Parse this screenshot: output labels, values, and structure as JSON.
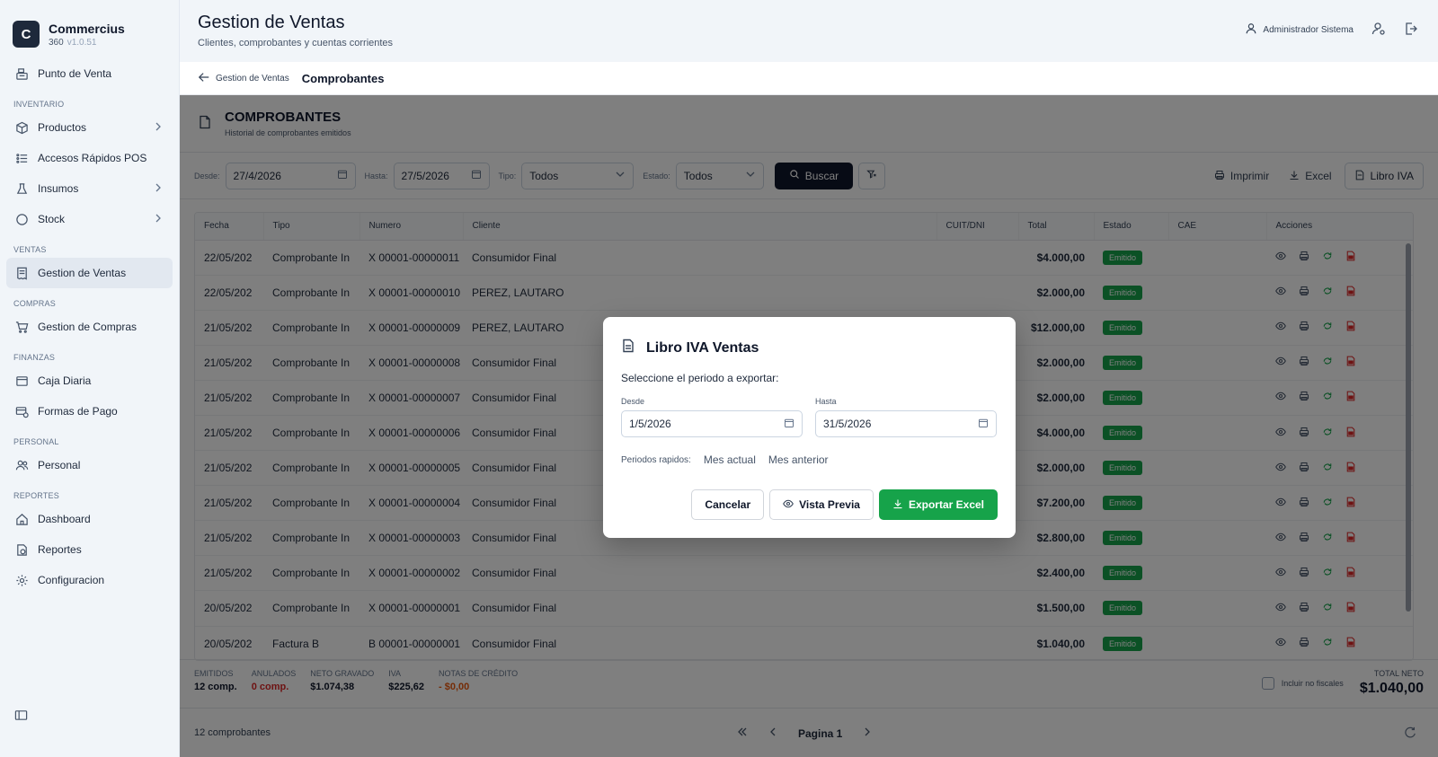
{
  "brand": {
    "logo_letter": "C",
    "name": "Commercius",
    "sub": "360",
    "version": "v1.0.51"
  },
  "sidebar": {
    "pos": "Punto de Venta",
    "sections": {
      "inventario": "INVENTARIO",
      "ventas": "VENTAS",
      "compras": "COMPRAS",
      "finanzas": "FINANZAS",
      "personal": "PERSONAL",
      "reportes": "REPORTES"
    },
    "items": {
      "productos": "Productos",
      "accesos": "Accesos Rápidos POS",
      "insumos": "Insumos",
      "stock": "Stock",
      "gestion_ventas": "Gestion de Ventas",
      "gestion_compras": "Gestion de Compras",
      "caja": "Caja Diaria",
      "formas_pago": "Formas de Pago",
      "personal": "Personal",
      "dashboard": "Dashboard",
      "reportes": "Reportes",
      "configuracion": "Configuracion"
    }
  },
  "header": {
    "title": "Gestion de Ventas",
    "subtitle": "Clientes, comprobantes y cuentas corrientes",
    "user": "Administrador Sistema"
  },
  "breadcrumb": {
    "back": "Gestion de Ventas",
    "current": "Comprobantes"
  },
  "section": {
    "title": "COMPROBANTES",
    "subtitle": "Historial de comprobantes emitidos"
  },
  "filters": {
    "desde_label": "Desde:",
    "desde": "27/4/2026",
    "hasta_label": "Hasta:",
    "hasta": "27/5/2026",
    "tipo_label": "Tipo:",
    "tipo": "Todos",
    "estado_label": "Estado:",
    "estado": "Todos",
    "buscar": "Buscar",
    "imprimir": "Imprimir",
    "excel": "Excel",
    "libro_iva": "Libro IVA"
  },
  "table": {
    "columns": {
      "fecha": "Fecha",
      "tipo": "Tipo",
      "numero": "Numero",
      "cliente": "Cliente",
      "cuit": "CUIT/DNI",
      "total": "Total",
      "estado": "Estado",
      "cae": "CAE",
      "acciones": "Acciones"
    },
    "rows": [
      {
        "fecha": "22/05/202",
        "tipo": "Comprobante In",
        "numero": "X 00001-00000011",
        "cliente": "Consumidor Final",
        "total": "$4.000,00",
        "estado": "Emitido"
      },
      {
        "fecha": "22/05/202",
        "tipo": "Comprobante In",
        "numero": "X 00001-00000010",
        "cliente": "PEREZ, LAUTARO",
        "total": "$2.000,00",
        "estado": "Emitido"
      },
      {
        "fecha": "21/05/202",
        "tipo": "Comprobante In",
        "numero": "X 00001-00000009",
        "cliente": "PEREZ, LAUTARO",
        "total": "$12.000,00",
        "estado": "Emitido"
      },
      {
        "fecha": "21/05/202",
        "tipo": "Comprobante In",
        "numero": "X 00001-00000008",
        "cliente": "Consumidor Final",
        "total": "$2.000,00",
        "estado": "Emitido"
      },
      {
        "fecha": "21/05/202",
        "tipo": "Comprobante In",
        "numero": "X 00001-00000007",
        "cliente": "Consumidor Final",
        "total": "$2.000,00",
        "estado": "Emitido"
      },
      {
        "fecha": "21/05/202",
        "tipo": "Comprobante In",
        "numero": "X 00001-00000006",
        "cliente": "Consumidor Final",
        "total": "$4.000,00",
        "estado": "Emitido"
      },
      {
        "fecha": "21/05/202",
        "tipo": "Comprobante In",
        "numero": "X 00001-00000005",
        "cliente": "Consumidor Final",
        "total": "$2.000,00",
        "estado": "Emitido"
      },
      {
        "fecha": "21/05/202",
        "tipo": "Comprobante In",
        "numero": "X 00001-00000004",
        "cliente": "Consumidor Final",
        "total": "$7.200,00",
        "estado": "Emitido"
      },
      {
        "fecha": "21/05/202",
        "tipo": "Comprobante In",
        "numero": "X 00001-00000003",
        "cliente": "Consumidor Final",
        "total": "$2.800,00",
        "estado": "Emitido"
      },
      {
        "fecha": "21/05/202",
        "tipo": "Comprobante In",
        "numero": "X 00001-00000002",
        "cliente": "Consumidor Final",
        "total": "$2.400,00",
        "estado": "Emitido"
      },
      {
        "fecha": "20/05/202",
        "tipo": "Comprobante In",
        "numero": "X 00001-00000001",
        "cliente": "Consumidor Final",
        "total": "$1.500,00",
        "estado": "Emitido"
      },
      {
        "fecha": "20/05/202",
        "tipo": "Factura B",
        "numero": "B 00001-00000001",
        "cliente": "Consumidor Final",
        "total": "$1.040,00",
        "estado": "Emitido"
      }
    ]
  },
  "totals": {
    "emitidos_label": "EMITIDOS",
    "emitidos": "12 comp.",
    "anulados_label": "ANULADOS",
    "anulados": "0 comp.",
    "neto_label": "NETO GRAVADO",
    "neto": "$1.074,38",
    "iva_label": "IVA",
    "iva": "$225,62",
    "nc_label": "NOTAS DE CRÉDITO",
    "nc": "- $0,00",
    "incluir": "Incluir no fiscales",
    "total_neto_label": "TOTAL NETO",
    "total_neto": "$1.040,00"
  },
  "footer": {
    "count": "12 comprobantes",
    "page": "Pagina 1"
  },
  "modal": {
    "title": "Libro IVA Ventas",
    "desc": "Seleccione el periodo a exportar:",
    "desde_label": "Desde",
    "desde": "1/5/2026",
    "hasta_label": "Hasta",
    "hasta": "31/5/2026",
    "quick_label": "Periodos rapidos:",
    "mes_actual": "Mes actual",
    "mes_anterior": "Mes anterior",
    "cancelar": "Cancelar",
    "vista_previa": "Vista Previa",
    "exportar": "Exportar Excel"
  }
}
